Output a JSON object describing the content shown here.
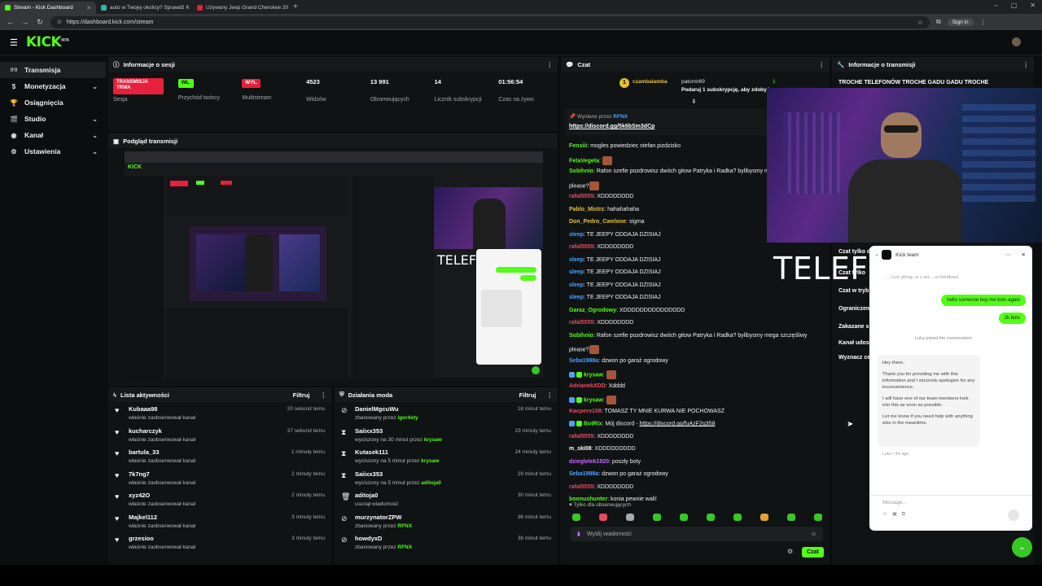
{
  "browser": {
    "tabs": [
      {
        "title": "Stream - Kick Dashboard",
        "color": "#53fc18",
        "active": true
      },
      {
        "title": "auto w Twojej okolicy? Sprawdź K",
        "color": "#2bb9a6",
        "active": false
      },
      {
        "title": "Używany Jeep Grand Cherokee 20",
        "color": "#e5213b",
        "active": false
      }
    ],
    "url": "https://dashboard.kick.com/stream",
    "signin": "Sign in"
  },
  "brand": {
    "logo": "KICK",
    "logo_sup": "BETA",
    "accent": "#53fc18"
  },
  "sidebar": {
    "items": [
      {
        "label": "Transmisja",
        "icon": "broadcast-icon",
        "chev": ""
      },
      {
        "label": "Monetyzacja",
        "icon": "money-icon",
        "chev": "⌄"
      },
      {
        "label": "Osiągnięcia",
        "icon": "trophy-icon",
        "chev": ""
      },
      {
        "label": "Studio",
        "icon": "studio-icon",
        "chev": "⌄"
      },
      {
        "label": "Kanał",
        "icon": "channel-icon",
        "chev": "⌄"
      },
      {
        "label": "Ustawienia",
        "icon": "gear-icon",
        "chev": "⌄"
      }
    ]
  },
  "session": {
    "title": "Informacje o sesji",
    "cells": [
      {
        "value": "TRANSMISJA TRWA",
        "label": "Sesja",
        "kind": "red"
      },
      {
        "value": "WŁ.",
        "label": "Przychód twórcy",
        "kind": "green"
      },
      {
        "value": "WYŁ.",
        "label": "Multistream",
        "kind": "red2"
      },
      {
        "value": "4523",
        "label": "Widzów",
        "kind": "text"
      },
      {
        "value": "13 991",
        "label": "Obserwujących",
        "kind": "text"
      },
      {
        "value": "14",
        "label": "Licznik subskrypcji",
        "kind": "text"
      },
      {
        "value": "01:56:54",
        "label": "Czas na żywo",
        "kind": "text"
      }
    ]
  },
  "preview": {
    "title": "Podgląd transmisji"
  },
  "activity": {
    "title": "Lista aktywności",
    "filter": "Filtruj",
    "rows": [
      {
        "name": "Kubaaa98",
        "sub": "właśnie zaobserwował kanał",
        "time": "20 sekund temu"
      },
      {
        "name": "kucharczyk",
        "sub": "właśnie zaobserwował kanał",
        "time": "37 sekund temu"
      },
      {
        "name": "bartula_33",
        "sub": "właśnie zaobserwował kanał",
        "time": "1 minutę temu"
      },
      {
        "name": "7k7ng7",
        "sub": "właśnie zaobserwował kanał",
        "time": "2 minuty temu"
      },
      {
        "name": "xyz42O",
        "sub": "właśnie zaobserwował kanał",
        "time": "2 minuty temu"
      },
      {
        "name": "Majkel112",
        "sub": "właśnie zaobserwował kanał",
        "time": "3 minuty temu"
      },
      {
        "name": "grzesioo",
        "sub": "właśnie zaobserwował kanał",
        "time": "3 minuty temu"
      }
    ]
  },
  "modlog": {
    "title": "Działania moda",
    "filter": "Filtruj",
    "rows": [
      {
        "name": "DanielMgcuWu",
        "sub": "zbanowany przez ",
        "by": "lgor4sty",
        "time": "18 minut temu",
        "icon": "ban-icon"
      },
      {
        "name": "Saiixx353",
        "sub": "wyciszony na 30 minut przez ",
        "by": "krysaw",
        "time": "23 minuty temu",
        "icon": "timer-icon"
      },
      {
        "name": "Kutasek111",
        "sub": "wyciszony na 5 minut przez ",
        "by": "krysaw",
        "time": "24 minuty temu",
        "icon": "timer-icon"
      },
      {
        "name": "Saiixx353",
        "sub": "wyciszony na 5 minut przez ",
        "by": "aditoja0",
        "time": "29 minut temu",
        "icon": "timer-icon"
      },
      {
        "name": "aditoja0",
        "sub": "usunął wiadomość",
        "by": "",
        "time": "30 minut temu",
        "icon": "trash-icon"
      },
      {
        "name": "murzynatorZPW",
        "sub": "zbanowany przez ",
        "by": "RFNX",
        "time": "36 minut temu",
        "icon": "ban-icon"
      },
      {
        "name": "howdyxD",
        "sub": "zbanowany przez ",
        "by": "RFNX",
        "time": "38 minut temu",
        "icon": "ban-icon"
      }
    ]
  },
  "chat": {
    "title": "Czat",
    "top_user": "czambalamba",
    "top_user_count": "1",
    "gift_user": "patomir69",
    "gift_text": "Podaruj 1 subskrypcję, aby zdobyć",
    "gift_count": "1",
    "pinned_label": "Wysłane przez",
    "pinned_by": "RFNX",
    "pinned_link": "https://discord.gg/5k6bSm3dCp",
    "messages": [
      {
        "user": "Fensiii",
        "color": "#53fc18",
        "text": "mogles powiedziec stefan pizdzisko",
        "emote": false
      },
      {
        "user": "FetaVegeta",
        "color": "#53fc18",
        "text": "",
        "emote": true
      },
      {
        "user": "Sobihnio",
        "color": "#53fc18",
        "text": "Rafon szefie pozdrowisz dwóch gitow Patryka i Radka? bylibysmy mega szczesliwy",
        "emote": false
      },
      {
        "user": "",
        "color": "#ffffff",
        "text": "please?",
        "emote": true
      },
      {
        "user": "rafal5555",
        "color": "#e84a5f",
        "text": "XDDDDDDDD",
        "emote": false
      },
      {
        "user": "Pablo_Mistrz",
        "color": "#e8c130",
        "text": "hahahahaha",
        "emote": false
      },
      {
        "user": "Don_Pedro_Cwelone",
        "color": "#e8c130",
        "text": "sigma",
        "emote": false
      },
      {
        "user": "sleep",
        "color": "#4aa3ff",
        "text": "TE JEEPY ODDAJA DZISIAJ",
        "emote": false
      },
      {
        "user": "rafal5555",
        "color": "#e84a5f",
        "text": "XDDDDDDDD",
        "emote": false
      },
      {
        "user": "sleep",
        "color": "#4aa3ff",
        "text": "TE JEEPY ODDAJA DZISIAJ",
        "emote": false
      },
      {
        "user": "sleep",
        "color": "#4aa3ff",
        "text": "TE JEEPY ODDAJA DZISIAJ",
        "emote": false
      },
      {
        "user": "sleep",
        "color": "#4aa3ff",
        "text": "TE JEEPY ODDAJA DZISIAJ",
        "emote": false
      },
      {
        "user": "sleep",
        "color": "#4aa3ff",
        "text": "TE JEEPY ODDAJA DZISIAJ",
        "emote": false
      },
      {
        "user": "Garaz_Ogrodowy",
        "color": "#53fc18",
        "text": "XDDDDDDDDDDDDDDD",
        "emote": false
      },
      {
        "user": "rafal5555",
        "color": "#e84a5f",
        "text": "XDDDDDDDD",
        "emote": false
      },
      {
        "user": "Sobihnio",
        "color": "#53fc18",
        "text": "Rafon szefie pozdrowisz dwóch gitow Patryka i Radka? bylibysmy mega szczęśliwy",
        "emote": false
      },
      {
        "user": "",
        "color": "#ffffff",
        "text": "please?",
        "emote": true
      },
      {
        "user": "Seba1998a",
        "color": "#4aa3ff",
        "text": "dzwon po garaż ogrodowy",
        "emote": false
      },
      {
        "user": "krysaw",
        "color": "#53fc18",
        "text": "",
        "emote": true
      },
      {
        "user": "AdrianekXDD",
        "color": "#e84a5f",
        "text": "Xdddd",
        "emote": false
      },
      {
        "user": "krysaw",
        "color": "#53fc18",
        "text": "",
        "emote": true
      },
      {
        "user": "Kacpero108",
        "color": "#e84a5f",
        "text": "TOMASZ TY MNIE KURWA NIE POCHOWASZ",
        "emote": false
      },
      {
        "user": "BotRix",
        "color": "#53fc18",
        "text": "Mój discord - ",
        "link": "https://discord.gg/fuAzF2g358",
        "emote": false
      },
      {
        "user": "rafal5555",
        "color": "#e84a5f",
        "text": "XDDDDDDDD",
        "emote": false
      },
      {
        "user": "m_ski08",
        "color": "#ffffff",
        "text": "XDDDDDDDDD",
        "emote": false
      },
      {
        "user": "dzieglelek1920",
        "color": "#c56bff",
        "text": "poszły boty",
        "emote": false
      },
      {
        "user": "Seba1998a",
        "color": "#4aa3ff",
        "text": "dzwon po garaż ogrodowy",
        "emote": false
      },
      {
        "user": "rafal5555",
        "color": "#e84a5f",
        "text": "XDDDDDDDD",
        "emote": false
      },
      {
        "user": "boonushunter",
        "color": "#53fc18",
        "text": "konia pewnie wali!",
        "emote": false
      }
    ],
    "followers_only": "Tylko dla obserwujących",
    "input_placeholder": "Wyślij wiadomość",
    "send_label": "Czat"
  },
  "stream_info": {
    "title": "Informacje o transmisji",
    "stream_title": "TROCHE TELEFONÓW TROCHE GADU GADU TROCHE",
    "rows": [
      "Czat tylko d",
      "Czat tylko",
      "Czat w tryb",
      "Ograniczen",
      "Zakazane s",
      "Kanał udost",
      "Wyznacz ce"
    ]
  },
  "overlay": {
    "text": "TELEFO"
  },
  "support": {
    "team": "Kick team",
    "intro": "... Lust ything, or s are ...ur feedback.",
    "bubble1": "hello someone buy me bots again",
    "bubble2": "2k bots",
    "joined": "Luka joined the conversation",
    "msg": [
      "Hey there,",
      "Thank you for providing me with this information and I sincerely apologize for any inconvenience.",
      "I will have one of our team members look into this as soon as possible.",
      "Let me know if you need help with anything else in the meantime."
    ],
    "meta": "Luka • 3m ago",
    "input_placeholder": "Message..."
  }
}
